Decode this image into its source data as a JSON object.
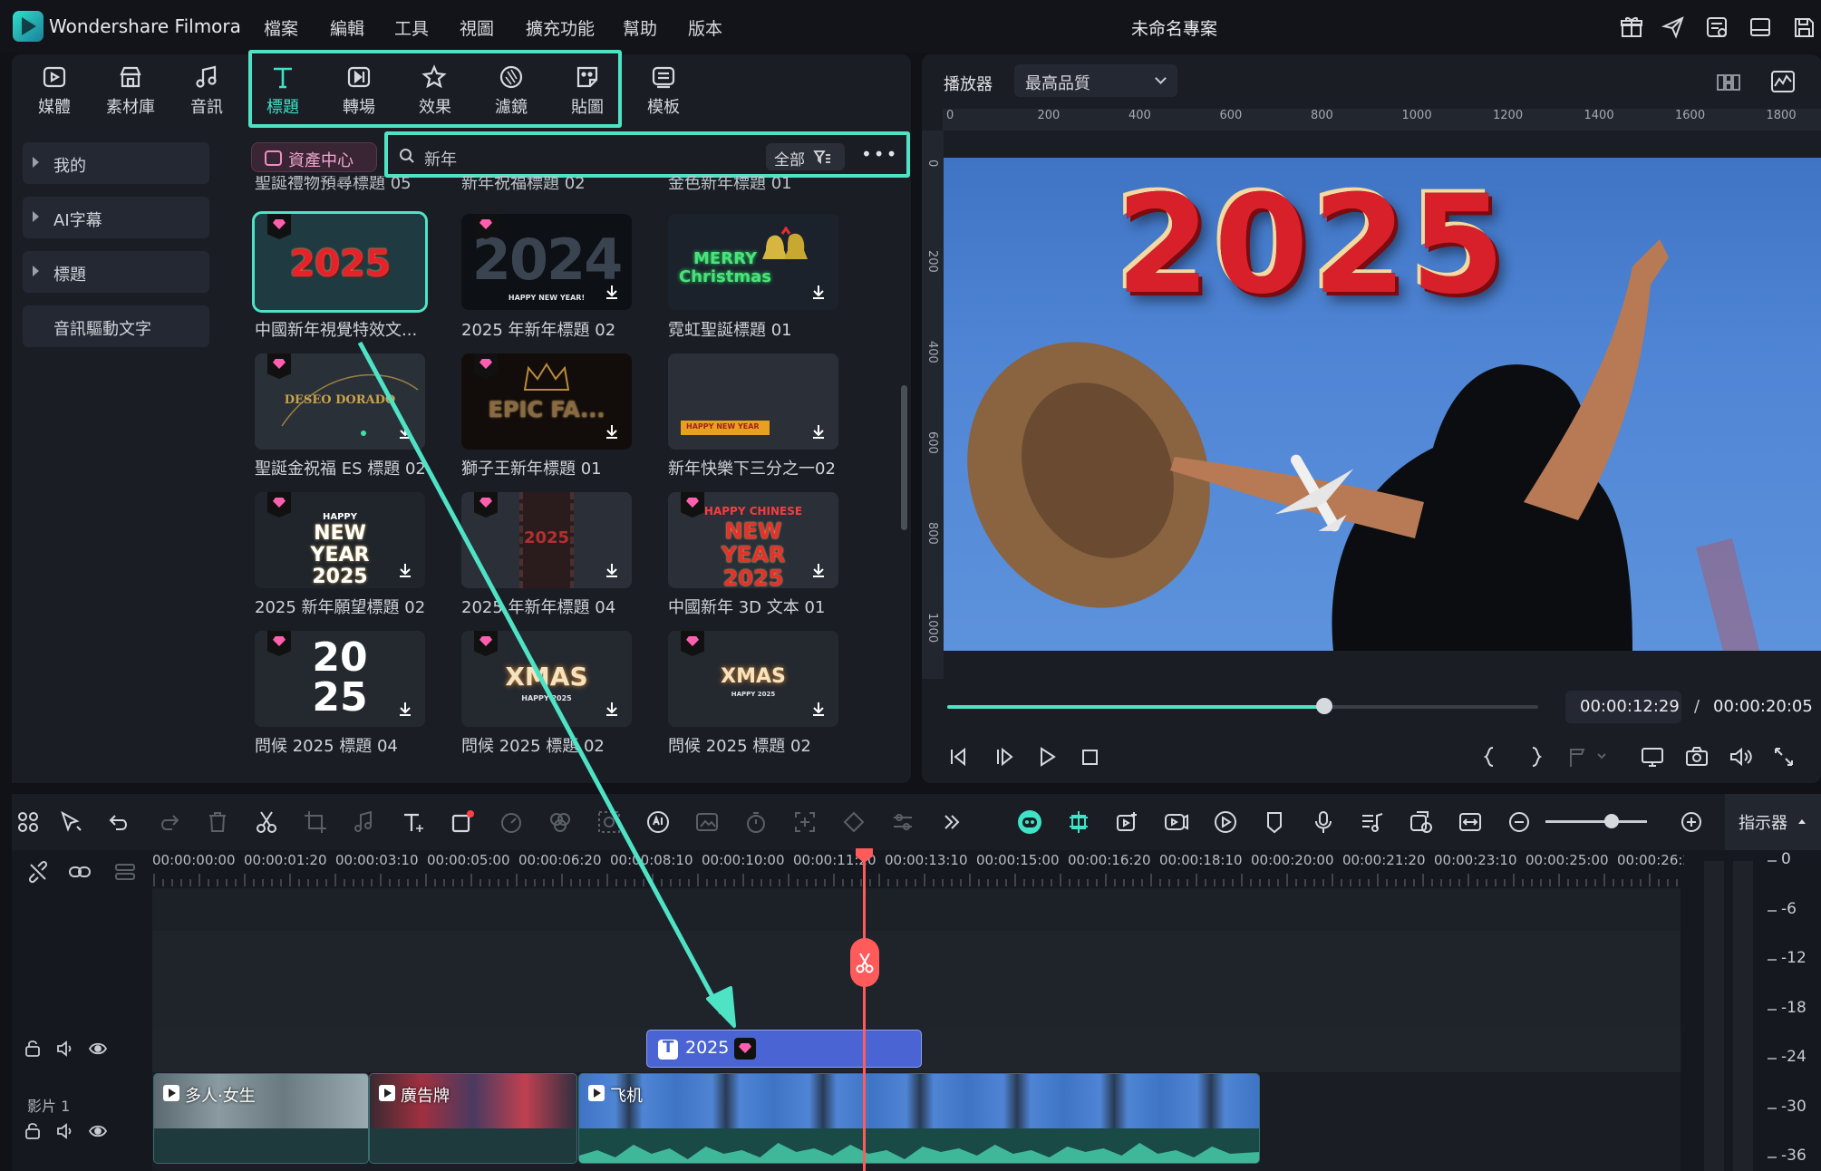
{
  "app": {
    "name": "Wondershare Filmora",
    "project_title": "未命名專案",
    "menu": [
      "檔案",
      "編輯",
      "工具",
      "視圖",
      "擴充功能",
      "幫助",
      "版本"
    ]
  },
  "library_tabs": [
    {
      "label": "媒體",
      "icon": "media-icon"
    },
    {
      "label": "素材庫",
      "icon": "stock-icon"
    },
    {
      "label": "音訊",
      "icon": "music-note-icon"
    },
    {
      "label": "標題",
      "icon": "text-t-icon",
      "active": true
    },
    {
      "label": "轉場",
      "icon": "transition-icon"
    },
    {
      "label": "效果",
      "icon": "effects-star-icon"
    },
    {
      "label": "濾鏡",
      "icon": "filter-icon"
    },
    {
      "label": "貼圖",
      "icon": "sticker-icon"
    },
    {
      "label": "模板",
      "icon": "template-icon"
    }
  ],
  "sidebar": {
    "items": [
      {
        "label": "我的",
        "expandable": true
      },
      {
        "label": "AI字幕",
        "expandable": true
      },
      {
        "label": "標題",
        "expandable": true
      },
      {
        "label": "音訊驅動文字",
        "expandable": false
      }
    ]
  },
  "search": {
    "asset_center_label": "資產中心",
    "query": "新年",
    "filter_label": "全部",
    "more": "•••"
  },
  "partial_row_labels": [
    "聖誕禮物預尋標題 05",
    "新年祝福標題 02",
    "金色新年標題 01"
  ],
  "cards": [
    {
      "label": "中國新年視覺特效文...",
      "art": "2025",
      "selected": true
    },
    {
      "label": "2025 年新年標題 02",
      "art": "2024",
      "sub": "HAPPY NEW YEAR!"
    },
    {
      "label": "霓虹聖誕標題 01",
      "art": "MERRY Christmas"
    },
    {
      "label": "聖誕金祝福 ES 標題 02",
      "art": "DESEO DORADO"
    },
    {
      "label": "獅子王新年標題 01",
      "art": "EPIC FA..."
    },
    {
      "label": "新年快樂下三分之一02",
      "art": "HAPPY NEW YEAR"
    },
    {
      "label": "2025 新年願望標題 02",
      "art": "NEW YEAR 2025",
      "sub": "HAPPY"
    },
    {
      "label": "2025 年新年標題 04",
      "art": "2025"
    },
    {
      "label": "中國新年 3D 文本 01",
      "art": "NEW YEAR 2025",
      "sub": "HAPPY CHINESE"
    },
    {
      "label": "問候 2025 標題 04",
      "art": "20 25"
    },
    {
      "label": "問候 2025 標題 02",
      "art": "XMAS",
      "sub": "HAPPY 2025"
    },
    {
      "label": "問候 2025 標題 02",
      "art": "XMAS",
      "sub": "HAPPY 2025"
    }
  ],
  "player": {
    "label": "播放器",
    "quality": "最高品質",
    "ruler_top": [
      "0",
      "200",
      "400",
      "600",
      "800",
      "1000",
      "1200",
      "1400",
      "1600",
      "1800"
    ],
    "ruler_left": [
      "0",
      "200",
      "400",
      "600",
      "800",
      "1000"
    ],
    "overlay_text": "2025",
    "current_time": "00:00:12:29",
    "separator": "/",
    "total_time": "00:00:20:05",
    "progress": 0.638
  },
  "timeline": {
    "indicator_label": "指示器",
    "timecodes": [
      "00:00:00:00",
      "00:00:01:20",
      "00:00:03:10",
      "00:00:05:00",
      "00:00:06:20",
      "00:00:08:10",
      "00:00:10:00",
      "00:00:11:20",
      "00:00:13:10",
      "00:00:15:00",
      "00:00:16:20",
      "00:00:18:10",
      "00:00:20:00",
      "00:00:21:20",
      "00:00:23:10",
      "00:00:25:00",
      "00:00:26:2"
    ],
    "title_clip": "2025",
    "video_track_label": "影片 1",
    "clips": [
      {
        "name": "多人·女生"
      },
      {
        "name": "廣告牌"
      },
      {
        "name": "飞机"
      }
    ],
    "db_scale": [
      "0",
      "-6",
      "-12",
      "-18",
      "-24",
      "-30",
      "-36"
    ]
  },
  "colors": {
    "accent": "#4fe3c6",
    "playhead": "#ff5b5b",
    "title_clip": "#4a64d4",
    "panel_bg": "#1a1d24"
  }
}
